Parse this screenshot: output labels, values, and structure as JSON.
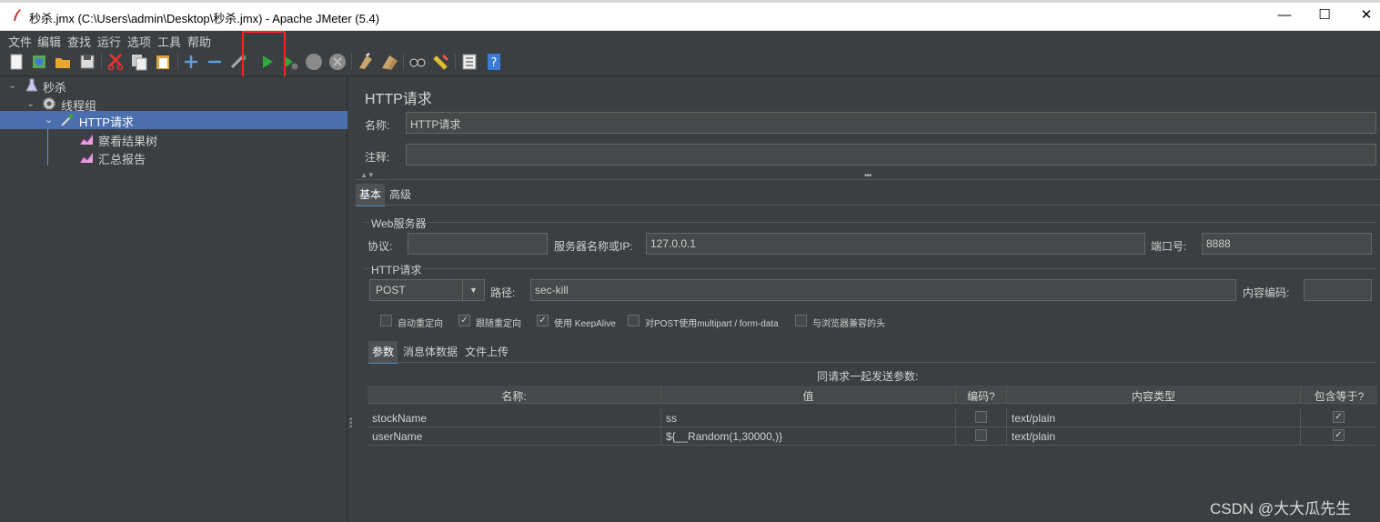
{
  "window": {
    "title": "秒杀.jmx (C:\\Users\\admin\\Desktop\\秒杀.jmx) - Apache JMeter (5.4)",
    "minimize": "—",
    "maximize": "☐",
    "close": "✕"
  },
  "menu": [
    "文件",
    "编辑",
    "查找",
    "运行",
    "选项",
    "工具",
    "帮助"
  ],
  "toolbar_icons": [
    "new-icon",
    "templates-icon",
    "open-icon",
    "save-icon",
    "cut-icon",
    "copy-icon",
    "paste-icon",
    "expand-icon",
    "collapse-icon",
    "toggle-icon",
    "start-icon",
    "start-no-pauses-icon",
    "stop-icon",
    "shutdown-icon",
    "clear-icon",
    "clear-all-icon",
    "search-icon",
    "reset-search-icon",
    "function-helper-icon",
    "help-icon"
  ],
  "tree": {
    "root": "秒杀",
    "thread_group": "线程组",
    "http_request": "HTTP请求",
    "children": [
      "察看结果树",
      "汇总报告"
    ]
  },
  "panel": {
    "title": "HTTP请求",
    "name_label": "名称:",
    "name_value": "HTTP请求",
    "comment_label": "注释:",
    "comment_value": "",
    "tabs": [
      "基本",
      "高级"
    ],
    "web_server_group": "Web服务器",
    "protocol_label": "协议:",
    "protocol_value": "",
    "server_label": "服务器名称或IP:",
    "server_value": "127.0.0.1",
    "port_label": "端口号:",
    "port_value": "8888",
    "http_group": "HTTP请求",
    "method": "POST",
    "path_label": "路径:",
    "path_value": "sec-kill",
    "encoding_label": "内容编码:",
    "encoding_value": "",
    "checkboxes": [
      {
        "label": "自动重定向",
        "checked": false
      },
      {
        "label": "跟随重定向",
        "checked": true
      },
      {
        "label": "使用 KeepAlive",
        "checked": true
      },
      {
        "label": "对POST使用multipart / form-data",
        "checked": false
      },
      {
        "label": "与浏览器兼容的头",
        "checked": false
      }
    ],
    "sub_tabs": [
      "参数",
      "消息体数据",
      "文件上传"
    ],
    "params_caption": "同请求一起发送参数:",
    "columns": [
      "名称:",
      "值",
      "编码?",
      "内容类型",
      "包含等于?"
    ],
    "rows": [
      {
        "name": "stockName",
        "value": "ss",
        "encode": false,
        "content_type": "text/plain",
        "include_equals": true
      },
      {
        "name": "userName",
        "value": "${__Random(1,30000,)}",
        "encode": false,
        "content_type": "text/plain",
        "include_equals": true
      }
    ]
  },
  "watermark": "CSDN @大大瓜先生",
  "check_mark": "✓"
}
